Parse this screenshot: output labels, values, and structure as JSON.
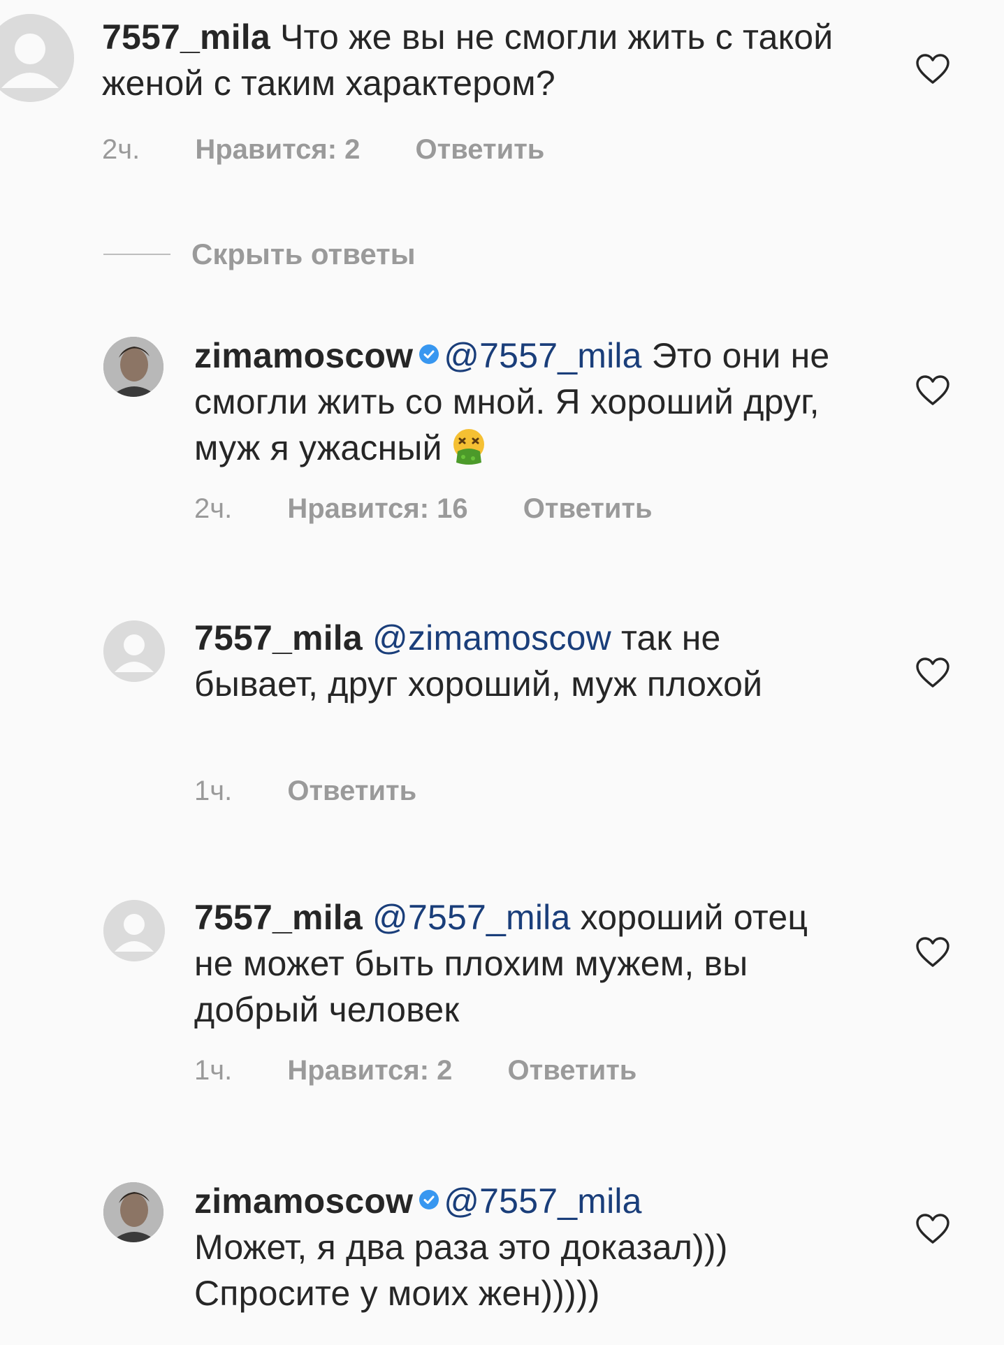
{
  "comments": [
    {
      "username": "7557_mila",
      "text": "Что же вы не смогли жить с такой женой с таким характером?",
      "time": "2ч.",
      "likes": "Нравится: 2",
      "reply": "Ответить"
    },
    {
      "username": "zimamoscow",
      "mention": "@7557_mila",
      "text": "Это они не смогли жить со мной. Я хороший друг, муж я ужасный",
      "time": "2ч.",
      "likes": "Нравится: 16",
      "reply": "Ответить"
    },
    {
      "username": "7557_mila",
      "mention": "@zimamoscow",
      "text": "так не бывает, друг хороший, муж плохой",
      "time": "1ч.",
      "reply": "Ответить"
    },
    {
      "username": "7557_mila",
      "mention": "@7557_mila",
      "text": "хороший отец не может быть плохим мужем, вы добрый человек",
      "time": "1ч.",
      "likes": "Нравится: 2",
      "reply": "Ответить"
    },
    {
      "username": "zimamoscow",
      "mention": "@7557_mila",
      "text": "Может, я два раза  это доказал))) Спросите у моих жен)))))"
    }
  ],
  "hide_replies": "Скрыть ответы",
  "icons": {
    "heart": "heart-outline-icon",
    "verified": "verified-badge-icon",
    "emoji": "nauseated-face-emoji",
    "avatar_default": "default-avatar-icon"
  },
  "colors": {
    "background": "#fafafa",
    "text": "#262626",
    "mention": "#1a3e7a",
    "secondary": "#9a9a9a",
    "verified": "#3897f0"
  }
}
